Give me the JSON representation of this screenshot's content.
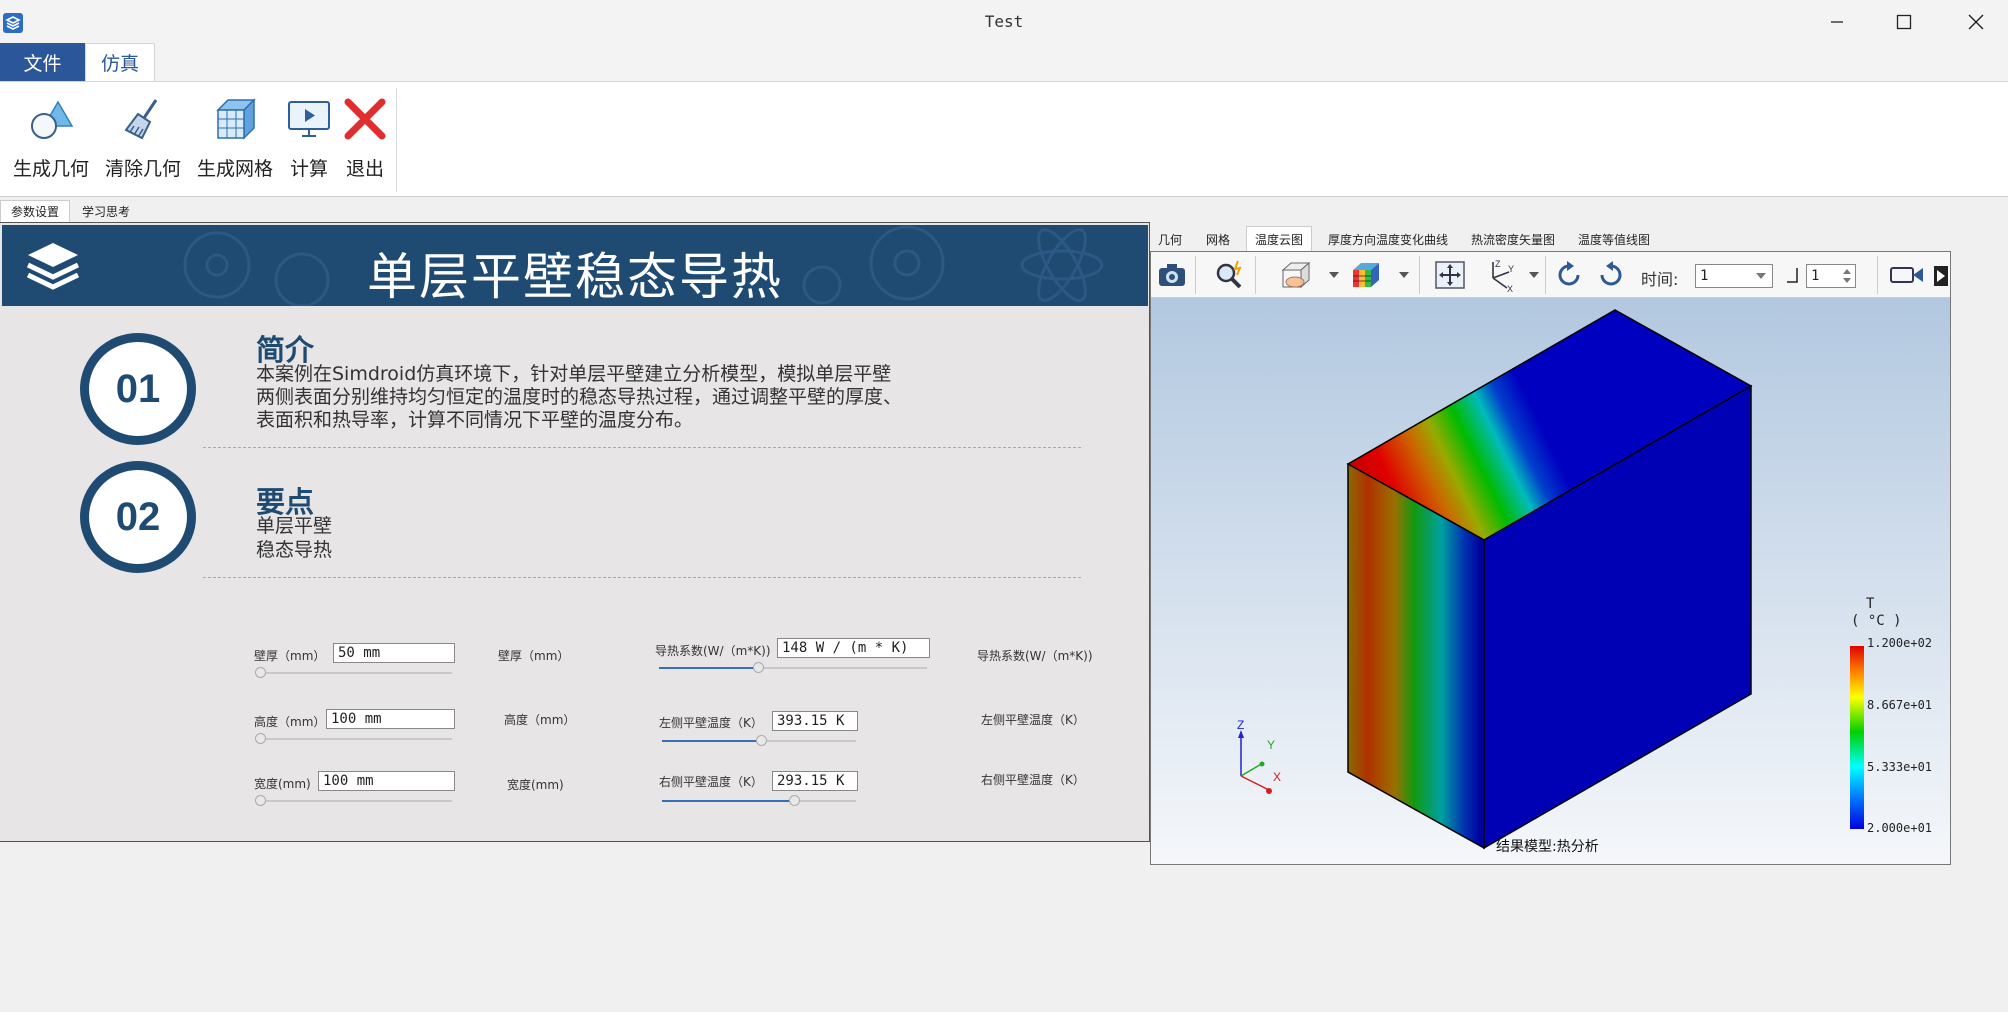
{
  "window": {
    "title": "Test"
  },
  "ribbon": {
    "tabs": [
      {
        "label": "文件"
      },
      {
        "label": "仿真"
      }
    ],
    "buttons": [
      {
        "label": "生成几何",
        "icon": "geometry-shapes-icon"
      },
      {
        "label": "清除几何",
        "icon": "broom-icon"
      },
      {
        "label": "生成网格",
        "icon": "mesh-cube-icon"
      },
      {
        "label": "计算",
        "icon": "monitor-play-icon"
      },
      {
        "label": "退出",
        "icon": "red-x-icon"
      }
    ]
  },
  "page_tabs": [
    {
      "label": "参数设置"
    },
    {
      "label": "学习思考"
    }
  ],
  "banner": {
    "title": "单层平壁稳态导热"
  },
  "sections": [
    {
      "number": "01",
      "title": "简介",
      "lines": [
        "本案例在Simdroid仿真环境下，针对单层平壁建立分析模型，模拟单层平壁",
        "两侧表面分别维持均匀恒定的温度时的稳态导热过程，通过调整平壁的厚度、",
        "表面积和热导率，计算不同情况下平壁的温度分布。"
      ]
    },
    {
      "number": "02",
      "title": "要点",
      "lines": [
        "单层平壁",
        "稳态导热"
      ]
    }
  ],
  "params": {
    "thickness": {
      "label": "壁厚（mm）",
      "value": "50 mm",
      "label2": "壁厚（mm）",
      "slider": 0.0
    },
    "height": {
      "label": "高度（mm）",
      "value": "100 mm",
      "label2": "高度（mm）",
      "slider": 0.0
    },
    "width": {
      "label": "宽度(mm)",
      "value": "100 mm",
      "label2": "宽度(mm)",
      "slider": 0.0
    },
    "conductivity": {
      "label": "导热系数(W/（m*K))",
      "value": "148 W / (m * K)",
      "label2": "导热系数(W/（m*K))",
      "slider": 0.37
    },
    "left_temp": {
      "label": "左侧平壁温度（K）",
      "value": "393.15 K",
      "label2": "左侧平壁温度（K）",
      "slider": 0.51
    },
    "right_temp": {
      "label": "右侧平壁温度（K）",
      "value": "293.15 K",
      "label2": "右侧平壁温度（K）",
      "slider": 0.68
    }
  },
  "viewer": {
    "tabs": [
      "几何",
      "网格",
      "温度云图",
      "厚度方向温度变化曲线",
      "热流密度矢量图",
      "温度等值线图"
    ],
    "active_tab": "温度云图",
    "toolbar": {
      "icons": [
        "camera-icon",
        "zoom-wand-icon",
        "view-cube-icon",
        "color-cube-icon",
        "fit-view-icon",
        "axes-icon",
        "rotate-ccw-icon",
        "rotate-cw-icon"
      ],
      "time_label": "时间:",
      "time_value": "1",
      "step_value": "1"
    },
    "legend": {
      "title": "T",
      "unit": "( °C )",
      "max": "1.200e+02",
      "v2": "8.667e+01",
      "v3": "5.333e+01",
      "min": "2.000e+01",
      "colors": [
        "#e00000",
        "#ffff00",
        "#00d000",
        "#00ffff",
        "#0000e0"
      ]
    },
    "caption": "结果模型:热分析",
    "triad": {
      "z": "Z",
      "y": "Y",
      "x": "X"
    }
  }
}
